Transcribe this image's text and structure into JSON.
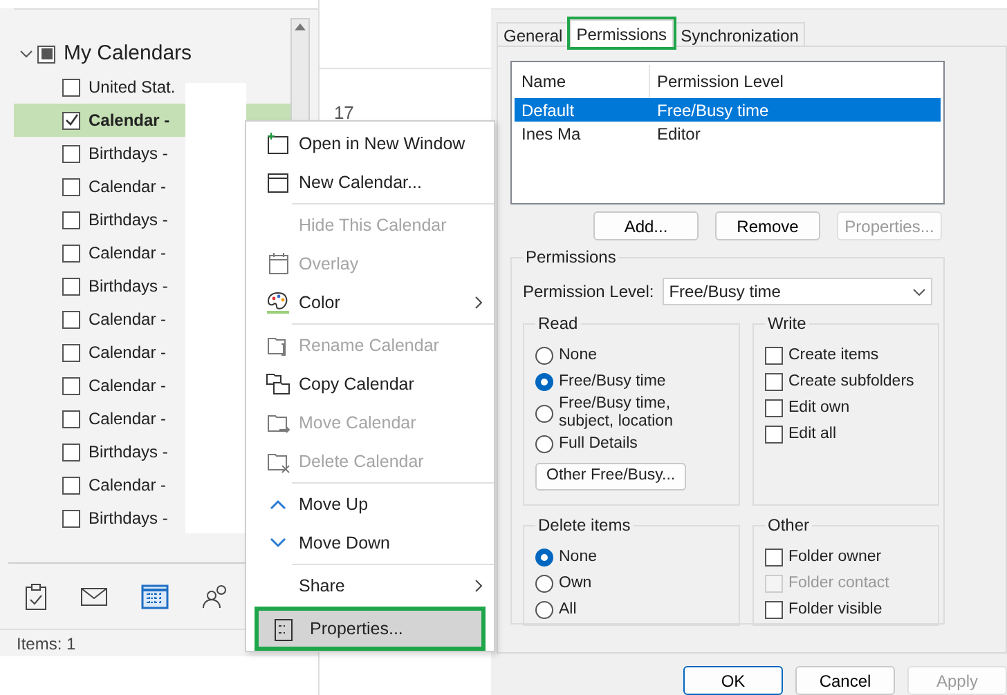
{
  "calendar_pane": {
    "group": {
      "label": "My Calendars",
      "expanded": true,
      "mixed": true
    },
    "calendars": [
      {
        "label": "United Stat.",
        "checked": false,
        "selected": false
      },
      {
        "label": "Calendar -",
        "checked": true,
        "selected": true
      },
      {
        "label": "Birthdays -",
        "checked": false,
        "selected": false
      },
      {
        "label": "Calendar -",
        "checked": false,
        "selected": false
      },
      {
        "label": "Birthdays -",
        "checked": false,
        "selected": false
      },
      {
        "label": "Calendar -",
        "checked": false,
        "selected": false
      },
      {
        "label": "Birthdays -",
        "checked": false,
        "selected": false
      },
      {
        "label": "Calendar -",
        "checked": false,
        "selected": false
      },
      {
        "label": "Calendar -",
        "checked": false,
        "selected": false
      },
      {
        "label": "Calendar -",
        "checked": false,
        "selected": false
      },
      {
        "label": "Calendar -",
        "checked": false,
        "selected": false
      },
      {
        "label": "Birthdays -",
        "checked": false,
        "selected": false
      },
      {
        "label": "Calendar -",
        "checked": false,
        "selected": false
      },
      {
        "label": "Birthdays -",
        "checked": false,
        "selected": false
      }
    ],
    "status_bar": "Items: 1"
  },
  "day_view": {
    "date": "17"
  },
  "context_menu": [
    {
      "label": "Open in New Window",
      "disabled": false,
      "submenu": false,
      "highlighted": false,
      "separator_before": false
    },
    {
      "label": "New Calendar...",
      "disabled": false,
      "submenu": false,
      "highlighted": false,
      "separator_before": false
    },
    {
      "label": "Hide This Calendar",
      "disabled": true,
      "submenu": false,
      "highlighted": false,
      "separator_before": true
    },
    {
      "label": "Overlay",
      "disabled": true,
      "submenu": false,
      "highlighted": false,
      "separator_before": false
    },
    {
      "label": "Color",
      "disabled": false,
      "submenu": true,
      "highlighted": false,
      "separator_before": false
    },
    {
      "label": "Rename Calendar",
      "disabled": true,
      "submenu": false,
      "highlighted": false,
      "separator_before": true
    },
    {
      "label": "Copy Calendar",
      "disabled": false,
      "submenu": false,
      "highlighted": false,
      "separator_before": false
    },
    {
      "label": "Move Calendar",
      "disabled": true,
      "submenu": false,
      "highlighted": false,
      "separator_before": false
    },
    {
      "label": "Delete Calendar",
      "disabled": true,
      "submenu": false,
      "highlighted": false,
      "separator_before": false
    },
    {
      "label": "Move Up",
      "disabled": false,
      "submenu": false,
      "highlighted": false,
      "separator_before": true
    },
    {
      "label": "Move Down",
      "disabled": false,
      "submenu": false,
      "highlighted": false,
      "separator_before": false
    },
    {
      "label": "Share",
      "disabled": false,
      "submenu": true,
      "highlighted": false,
      "separator_before": true
    },
    {
      "label": "Properties...",
      "disabled": false,
      "submenu": false,
      "highlighted": true,
      "separator_before": true
    }
  ],
  "dialog": {
    "tabs": [
      {
        "label": "General",
        "selected": false
      },
      {
        "label": "Permissions",
        "selected": true
      },
      {
        "label": "Synchronization",
        "selected": false
      }
    ],
    "list": {
      "columns": [
        "Name",
        "Permission Level"
      ],
      "rows": [
        {
          "cells": [
            "Default",
            "Free/Busy time"
          ],
          "selected": true
        },
        {
          "cells": [
            "Ines Ma",
            "Editor"
          ],
          "selected": false
        }
      ]
    },
    "list_buttons": [
      {
        "label": "Add...",
        "disabled": false
      },
      {
        "label": "Remove",
        "disabled": false
      },
      {
        "label": "Properties...",
        "disabled": true
      }
    ],
    "permissions": {
      "title": "Permissions",
      "level_label": "Permission Level:",
      "level_value": "Free/Busy time",
      "read": {
        "title": "Read",
        "options": [
          {
            "label": "None",
            "selected": false
          },
          {
            "label": "Free/Busy time",
            "selected": true
          },
          {
            "label": "Free/Busy time, subject, location",
            "selected": false
          },
          {
            "label": "Full Details",
            "selected": false
          }
        ],
        "button": "Other Free/Busy..."
      },
      "write": {
        "title": "Write",
        "options": [
          {
            "label": "Create items",
            "checked": false,
            "disabled": false
          },
          {
            "label": "Create subfolders",
            "checked": false,
            "disabled": false
          },
          {
            "label": "Edit own",
            "checked": false,
            "disabled": false
          },
          {
            "label": "Edit all",
            "checked": false,
            "disabled": false
          }
        ]
      },
      "delete": {
        "title": "Delete items",
        "options": [
          {
            "label": "None",
            "selected": true
          },
          {
            "label": "Own",
            "selected": false
          },
          {
            "label": "All",
            "selected": false
          }
        ]
      },
      "other": {
        "title": "Other",
        "options": [
          {
            "label": "Folder owner",
            "checked": false,
            "disabled": false
          },
          {
            "label": "Folder contact",
            "checked": false,
            "disabled": true
          },
          {
            "label": "Folder visible",
            "checked": false,
            "disabled": false
          }
        ]
      }
    },
    "footer_buttons": [
      {
        "label": "OK",
        "disabled": false,
        "default": true
      },
      {
        "label": "Cancel",
        "disabled": false,
        "default": false
      },
      {
        "label": "Apply",
        "disabled": true,
        "default": false
      }
    ]
  }
}
